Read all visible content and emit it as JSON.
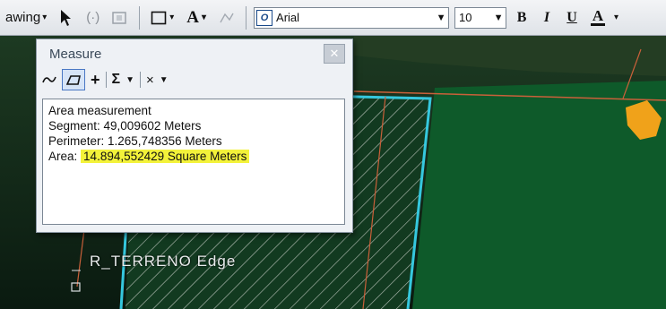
{
  "toolbar": {
    "drawing_label": "awing",
    "font_name": "Arial",
    "font_size": "10",
    "bold_label": "B",
    "italic_label": "I",
    "underline_label": "U",
    "font_color_label": "A"
  },
  "measure": {
    "title": "Measure",
    "results": {
      "mode": "Area measurement",
      "segment": "Segment: 49,009602 Meters",
      "perimeter": "Perimeter: 1.265,748356 Meters",
      "area_label": "Area:",
      "area_value": "14.894,552429 Square Meters"
    }
  },
  "map": {
    "parcel_label": "R_TERRENO Edge",
    "colors": {
      "parcel_outline": "#35c8de",
      "parcel_fill": "#0e5a2a",
      "hatch": "#b9c2b9",
      "boundary_line": "#c9603a",
      "highlight": "#f0a21a"
    }
  }
}
